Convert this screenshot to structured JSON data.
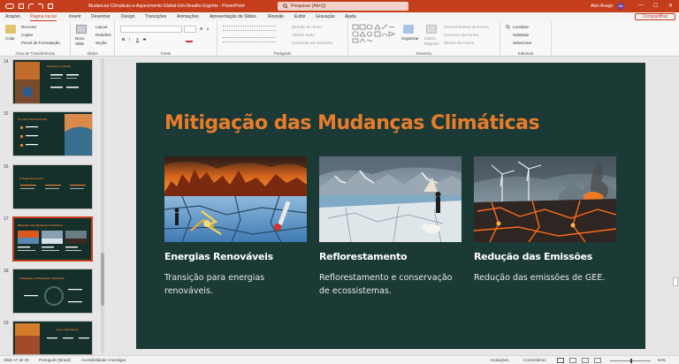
{
  "window": {
    "title": "Mudancas-Climaticas-e-Aquecimento-Global-Um-Desafio-Urgente  -  PowerPoint",
    "search_placeholder": "Pesquisar (Alt+Q)",
    "user_name": "Alex Araujo",
    "user_initials": "AA",
    "minimize": "—",
    "maximize": "☐",
    "close": "✕"
  },
  "menu": {
    "tabs": [
      "Arquivo",
      "Página Inicial",
      "Inserir",
      "Desenhar",
      "Design",
      "Transições",
      "Animações",
      "Apresentação de Slides",
      "Revisão",
      "Exibir",
      "Gravação",
      "Ajuda"
    ],
    "active": "Página Inicial",
    "share": "Compartilhar"
  },
  "ribbon": {
    "clipboard": {
      "paste": "Colar",
      "cut": "Recortar",
      "copy": "Copiar",
      "format_painter": "Pincel de Formatação",
      "label": "Área de Transferência"
    },
    "slides": {
      "new_slide": "Novo",
      "new_slide2": "Slide",
      "layout": "Layout",
      "reset": "Redefinir",
      "section": "Seção",
      "label": "Slides"
    },
    "font": {
      "label": "Fonte",
      "bold": "N",
      "italic": "I",
      "underline": "S",
      "strike": "S",
      "size_up": "A",
      "size_down": "A"
    },
    "paragraph": {
      "text_direction": "Direção do Texto",
      "align_text": "Alinhar Texto",
      "smartart": "Converter em SmartArt",
      "label": "Parágrafo"
    },
    "drawing": {
      "arrange": "Organizar",
      "quick_styles": "Estilos",
      "quick_styles2": "Rápidos",
      "shape_fill": "Preenchimento da Forma",
      "shape_outline": "Contorno da Forma",
      "shape_effects": "Efeitos de Forma",
      "label": "Desenho"
    },
    "editing": {
      "find": "Localizar",
      "replace": "Substituir",
      "select": "Selecionar",
      "label": "Editando"
    }
  },
  "thumbnails": [
    {
      "num": "14",
      "title": "Impactos no Brasil"
    },
    {
      "num": "15",
      "title": "Acordos Internacionais"
    },
    {
      "num": "16",
      "title": "O Papel da Ciência"
    },
    {
      "num": "17",
      "title": "Mitigação das Mudanças Climáticas",
      "active": true
    },
    {
      "num": "18",
      "title": "Adaptação às Mudanças Climáticas"
    },
    {
      "num": "19",
      "title": "Ações Individuais"
    }
  ],
  "slide": {
    "title": "Mitigação das Mudanças Climáticas",
    "columns": [
      {
        "heading": "Energias Renováveis",
        "text": "Transição para energias renováveis."
      },
      {
        "heading": "Reflorestamento",
        "text": "Reflorestamento e conservação de ecossistemas."
      },
      {
        "heading": "Redução das Emissões",
        "text": "Redução das emissões de GEE."
      }
    ]
  },
  "status": {
    "slide_of": "Slide 17 de 20",
    "language": "Português (Brasil)",
    "accessibility": "Acessibilidade: investigar",
    "notes": "Anotações",
    "comments": "Comentários",
    "zoom": "94%"
  },
  "colors": {
    "brand": "#c43e1c",
    "slide_bg": "#1b3a35",
    "title_orange": "#e87c2c"
  }
}
